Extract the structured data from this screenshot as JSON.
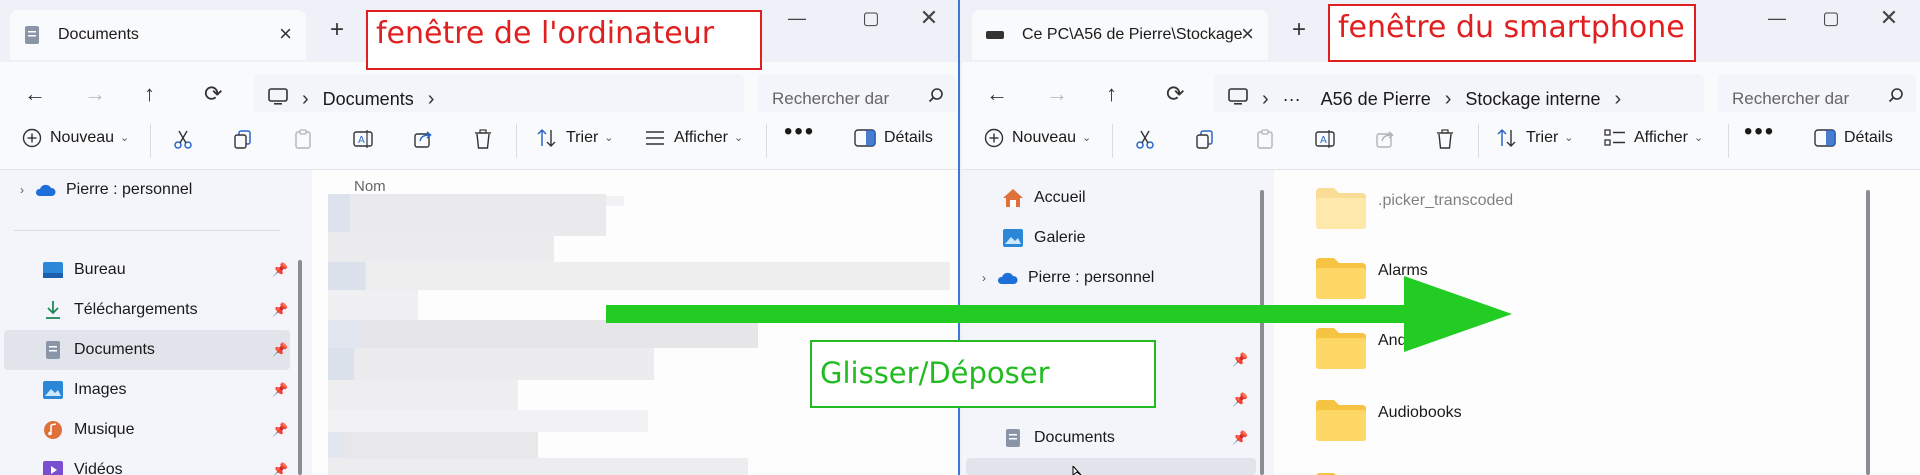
{
  "left_window": {
    "tab_title": "Documents",
    "path": [
      "Documents"
    ],
    "search_placeholder": "Rechercher dar",
    "toolbar": {
      "new": "Nouveau",
      "sort": "Trier",
      "view": "Afficher",
      "details": "Détails"
    },
    "column_header": "Nom",
    "sidebar": {
      "cloud": "Pierre : personnel",
      "items": [
        {
          "label": "Bureau",
          "icon": "desktop-icon"
        },
        {
          "label": "Téléchargements",
          "icon": "download-icon"
        },
        {
          "label": "Documents",
          "icon": "document-icon",
          "selected": true
        },
        {
          "label": "Images",
          "icon": "image-icon"
        },
        {
          "label": "Musique",
          "icon": "music-icon"
        },
        {
          "label": "Vidéos",
          "icon": "video-icon"
        }
      ]
    }
  },
  "right_window": {
    "tab_title": "Ce PC\\A56 de Pierre\\Stockage",
    "path": [
      "A56 de Pierre",
      "Stockage interne"
    ],
    "path_overflow": "···",
    "search_placeholder": "Rechercher dar",
    "toolbar": {
      "new": "Nouveau",
      "sort": "Trier",
      "view": "Afficher",
      "details": "Détails"
    },
    "sidebar": {
      "items": [
        {
          "label": "Accueil",
          "icon": "home-icon"
        },
        {
          "label": "Galerie",
          "icon": "gallery-icon"
        },
        {
          "label": "Pierre : personnel",
          "icon": "cloud-icon"
        },
        {
          "label": "Documents",
          "icon": "document-icon"
        }
      ]
    },
    "folders": [
      ".picker_transcoded",
      "Alarms",
      "Andro",
      "Audiobooks"
    ]
  },
  "annotations": {
    "computer": "fenêtre de l'ordinateur",
    "smartphone": "fenêtre du smartphone",
    "drag": "Glisser/Déposer"
  },
  "colors": {
    "accent": "#3b78d8",
    "arrow": "#22cc22",
    "annotation_red": "#e02020",
    "folder": "#f6c342"
  }
}
